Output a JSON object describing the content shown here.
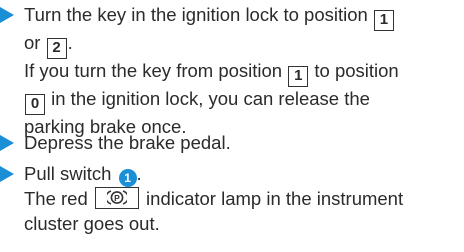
{
  "steps": [
    {
      "line1_pre": "Turn the key in the ignition lock to position",
      "key_a": "1",
      "line2_pre": "or",
      "key_b": "2",
      "line2_post": ".",
      "line3_pre": "If you turn the key from position",
      "key_c": "1",
      "line3_post": "to position",
      "key_d": "0",
      "line4_post": "in the ignition lock, you can release the",
      "line5": "parking brake once."
    },
    {
      "text": "Depress the brake pedal."
    },
    {
      "text_pre": "Pull switch",
      "switch_number": "1",
      "text_post": ".",
      "line2_pre": "The red",
      "lamp_symbol": "P",
      "line2_post": "indicator lamp in the instrument",
      "line3": "cluster goes out."
    }
  ],
  "colors": {
    "accent": "#1a8fd6",
    "text": "#2b2b2b"
  },
  "icons": [
    "bullet-arrow-icon",
    "parking-brake-indicator-icon",
    "switch-number-badge"
  ]
}
